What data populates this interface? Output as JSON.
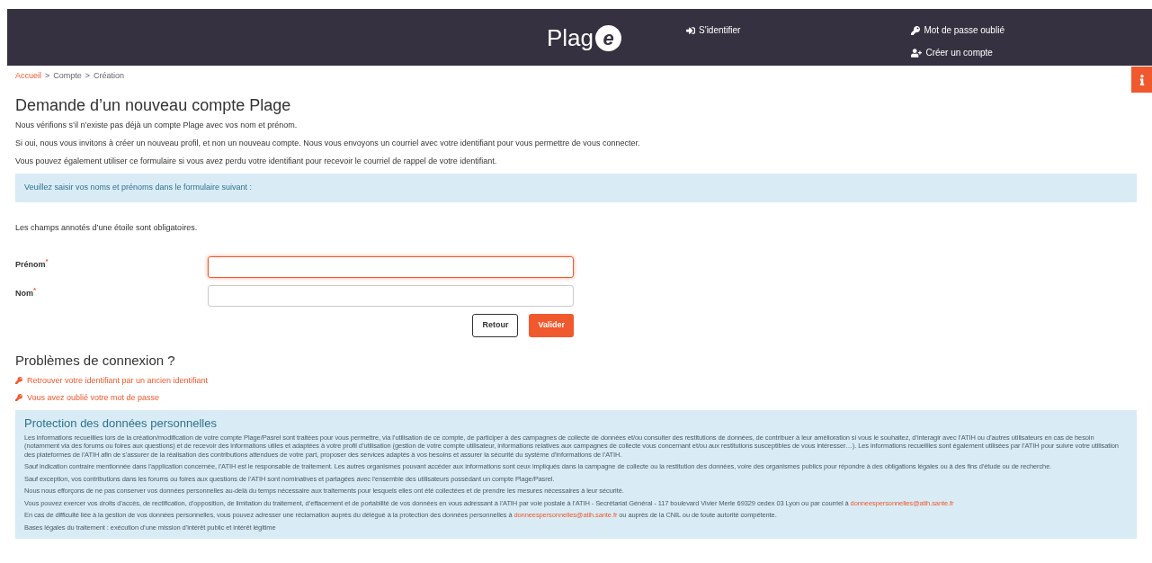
{
  "header": {
    "logo_text": "Plag",
    "logo_badge": "e",
    "login_link": "S'identifier",
    "forgot_link": "Mot de passe oublié",
    "create_link": "Créer un compte"
  },
  "breadcrumb": [
    {
      "label": "Accueil",
      "link": true
    },
    {
      "label": "Compte",
      "link": false
    },
    {
      "label": "Création",
      "link": false
    }
  ],
  "breadcrumb_separator": ">",
  "title": "Demande d’un nouveau compte Plage",
  "intro": [
    "Nous vérifions s’il n’existe pas déjà un compte Plage avec vos nom et prénom.",
    "Si oui, nous vous invitons à créer un nouveau profil, et non un nouveau compte. Nous vous envoyons un courriel avec votre identifiant pour vous permettre de vous connecter.",
    "Vous pouvez également utiliser ce formulaire si vous avez perdu votre identifiant pour recevoir le courriel de rappel de votre identifiant."
  ],
  "alert": "Veuillez saisir vos noms et prénoms dans le formulaire suivant :",
  "required_note": "Les champs annotés d’une étoile sont obligatoires.",
  "fields": [
    {
      "label": "Prénom",
      "required_mark": "*",
      "focused": true
    },
    {
      "label": "Nom",
      "required_mark": "*",
      "focused": false
    }
  ],
  "buttons": [
    {
      "label": "Retour",
      "kind": "secondary"
    },
    {
      "label": "Valider",
      "kind": "primary"
    }
  ],
  "problems": {
    "title": "Problèmes de connexion ?",
    "links": [
      "Retrouver votre identifiant par un ancien identifiant",
      "Vous avez oublié votre mot de passe"
    ]
  },
  "privacy": {
    "title": "Protection des données personnelles",
    "paragraphs": [
      {
        "text": "Les informations recueillies lors de la création/modification de votre compte Plage/Pasrel sont traitées pour vous permettre, via l’utilisation de ce compte, de participer à des campagnes de collecte de données et/ou consulter des restitutions de données, de contribuer à leur amélioration si vous le souhaitez, d’interagir avec l’ATIH ou d’autres utilisateurs en cas de besoin (notamment via des forums ou foires aux questions) et de recevoir des informations utiles et adaptées à votre profil d’utilisation (gestion de votre compte utilisateur, informations relatives aux campagnes de collecte vous concernant et/ou aux restitutions susceptibles de vous intéresser…). Les informations recueillies sont également utilisées par l’ATIH pour suivre votre utilisation des plateformes de l’ATIH afin de s’assurer de la réalisation des contributions attendues de votre part, proposer des services adaptés à vos besoins et assurer la sécurité du système d’informations de l’ATIH."
      },
      {
        "text": "Sauf indication contraire mentionnée dans l’application concernée, l’ATIH est le responsable de traitement. Les autres organismes pouvant accéder aux informations sont ceux impliqués dans la campagne de collecte ou la restitution des données, voire des organismes publics pour répondre à des obligations légales ou à des fins d’étude ou de recherche."
      },
      {
        "text": "Sauf exception, vos contributions dans les forums ou foires aux questions de l’ATIH sont nominatives et partagées avec l’ensemble des utilisateurs possédant un compte Plage/Pasrel."
      },
      {
        "text": "Nous nous efforçons de ne pas conserver vos données personnelles au-delà du temps nécessaire aux traitements pour lesquels elles ont été collectées et de prendre les mesures nécessaires à leur sécurité."
      },
      {
        "text": "Vous pouvez exercer vos droits d’accès, de rectification, d’opposition, de limitation du traitement, d’effacement et de portabilité de vos données en vous adressant à l’ATIH par voie postale à l’ATIH - Secrétariat Général - 117 boulevard Vivier Merle 69329 cedex 03 Lyon ou par courriel à",
        "link": "donneespersonnelles@atih.sante.fr"
      },
      {
        "text": "En cas de difficulté liée à la gestion de vos données personnelles, vous pouvez adresser une réclamation auprès du délégué à la protection des données personnelles à",
        "link": "donneespersonnelles@atih.sante.fr",
        "after": "ou auprès de la CNIL ou de toute autorité compétente."
      },
      {
        "text": "Bases légales du traitement : exécution d’une mission d’intérêt public et intérêt légitime"
      }
    ]
  }
}
